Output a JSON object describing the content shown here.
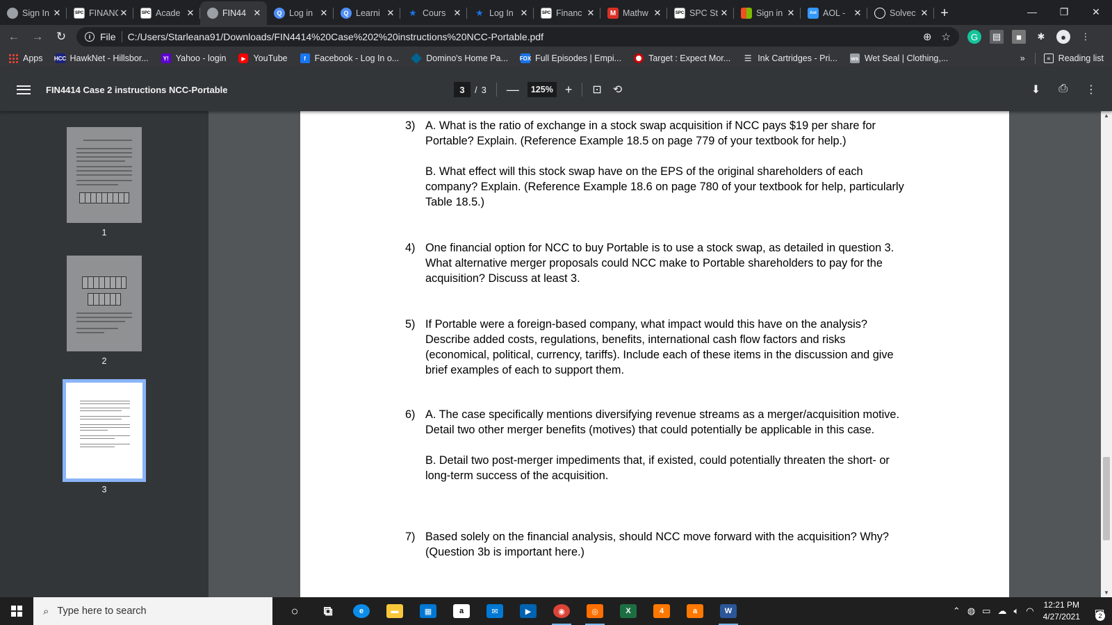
{
  "tabs": [
    {
      "title": "Sign In",
      "favicon": "globe-icon",
      "color": "#5f6368",
      "active": false
    },
    {
      "title": "FINANC",
      "favicon": "spc-icon",
      "color": "#ffffff",
      "active": false
    },
    {
      "title": "Acade",
      "favicon": "spc-icon",
      "color": "#ffffff",
      "active": false
    },
    {
      "title": "FIN44",
      "favicon": "globe-icon",
      "color": "#5f6368",
      "active": true
    },
    {
      "title": "Log in",
      "favicon": "q-icon",
      "color": "#4f8ef7",
      "active": false
    },
    {
      "title": "Learni",
      "favicon": "q-icon",
      "color": "#4f8ef7",
      "active": false
    },
    {
      "title": "Cours",
      "favicon": "star-icon",
      "color": "#1a73e8",
      "active": false
    },
    {
      "title": "Log In",
      "favicon": "star-icon",
      "color": "#1a73e8",
      "active": false
    },
    {
      "title": "Financ",
      "favicon": "spc-icon",
      "color": "#ffffff",
      "active": false
    },
    {
      "title": "Mathw",
      "favicon": "m-icon",
      "color": "#d93025",
      "active": false
    },
    {
      "title": "SPC St",
      "favicon": "spc-icon",
      "color": "#ffffff",
      "active": false
    },
    {
      "title": "Sign in",
      "favicon": "microsoft-icon",
      "color": "#f25022",
      "active": false
    },
    {
      "title": "AOL -",
      "favicon": "aol-icon",
      "color": "#3399ff",
      "active": false
    },
    {
      "title": "Solvec",
      "favicon": "solved-icon",
      "color": "#4285f4",
      "active": false
    }
  ],
  "url": {
    "scheme_label": "File",
    "path": "C:/Users/Starleana91/Downloads/FIN4414%20Case%202%20instructions%20NCC-Portable.pdf"
  },
  "bookmarks": [
    {
      "label": "Apps",
      "icon": "apps-grid-icon",
      "color": "#34a853"
    },
    {
      "label": "HawkNet - Hillsbor...",
      "icon": "hcc-icon",
      "color": "#1a237e"
    },
    {
      "label": "Yahoo - login",
      "icon": "yahoo-icon",
      "color": "#6001d2"
    },
    {
      "label": "YouTube",
      "icon": "youtube-icon",
      "color": "#ff0000"
    },
    {
      "label": "Facebook - Log In o...",
      "icon": "facebook-icon",
      "color": "#1877f2"
    },
    {
      "label": "Domino's Home Pa...",
      "icon": "dominos-icon",
      "color": "#006491"
    },
    {
      "label": "Full Episodes | Empi...",
      "icon": "fox-icon",
      "color": "#1a73e8"
    },
    {
      "label": "Target : Expect Mor...",
      "icon": "target-icon",
      "color": "#cc0000"
    },
    {
      "label": "Ink Cartridges - Pri...",
      "icon": "list-icon",
      "color": "#5f6368"
    },
    {
      "label": "Wet Seal | Clothing,...",
      "icon": "wetseal-icon",
      "color": "#5f6368"
    }
  ],
  "bookmarks_overflow": "»",
  "reading_list": "Reading list",
  "pdf": {
    "title": "FIN4414 Case 2 instructions NCC-Portable",
    "current_page": "3",
    "page_sep": "/",
    "total_pages": "3",
    "zoom": "125%",
    "thumbnail_labels": [
      "1",
      "2",
      "3"
    ]
  },
  "questions": [
    {
      "num": "3)",
      "paragraphs": [
        "A. What is the ratio of exchange in a stock swap acquisition if NCC pays $19 per share for Portable? Explain. (Reference Example 18.5 on page 779 of your textbook for help.)",
        "B. What effect will this stock swap have on the EPS of the original shareholders of each company? Explain. (Reference Example 18.6 on page 780 of your textbook for help, particularly Table 18.5.)"
      ]
    },
    {
      "num": "4)",
      "paragraphs": [
        "One financial option for NCC to buy Portable is to use a stock swap, as detailed in question 3. What alternative merger proposals could NCC make to Portable shareholders to pay for the acquisition? Discuss at least 3."
      ]
    },
    {
      "num": "5)",
      "paragraphs": [
        "If Portable were a foreign-based company, what impact would this have on the analysis? Describe added costs, regulations, benefits, international cash flow factors and risks (economical, political, currency, tariffs). Include each of these items in the discussion and give brief examples of each to support them."
      ]
    },
    {
      "num": "6)",
      "paragraphs": [
        "A. The case specifically mentions diversifying revenue streams as a merger/acquisition motive. Detail two other merger benefits (motives) that could potentially be applicable in this case.",
        "B. Detail two post-merger impediments that, if existed, could potentially threaten the short- or long-term success of the acquisition."
      ]
    },
    {
      "num": "7)",
      "paragraphs": [
        "Based solely on the financial analysis, should NCC move forward with the acquisition? Why? (Question 3b is important here.)"
      ]
    }
  ],
  "taskbar": {
    "search_placeholder": "Type here to search",
    "time": "12:21 PM",
    "date": "4/27/2021",
    "notification_count": "2",
    "apps": [
      {
        "name": "cortana-icon",
        "label": "○",
        "color": "transparent"
      },
      {
        "name": "task-view-icon",
        "label": "⧉",
        "color": "transparent"
      },
      {
        "name": "edge-icon",
        "label": "e",
        "color": "#0c8ce9"
      },
      {
        "name": "file-explorer-icon",
        "label": "▬",
        "color": "#f8c83a"
      },
      {
        "name": "store-icon",
        "label": "▦",
        "color": "#0078d4"
      },
      {
        "name": "amazon-icon",
        "label": "a",
        "color": "#ffffff"
      },
      {
        "name": "mail-icon",
        "label": "✉",
        "color": "#0078d4"
      },
      {
        "name": "media-player-icon",
        "label": "▶",
        "color": "#0063b1"
      },
      {
        "name": "chrome-icon",
        "label": "◉",
        "color": "#db4437"
      },
      {
        "name": "photo-app-icon",
        "label": "◎",
        "color": "#ff6f00"
      },
      {
        "name": "excel-icon",
        "label": "X",
        "color": "#1d6f42"
      },
      {
        "name": "avast-icon",
        "label": "4",
        "color": "#ff7800"
      },
      {
        "name": "avast-secure-icon",
        "label": "a",
        "color": "#ff7800"
      },
      {
        "name": "word-icon",
        "label": "W",
        "color": "#2b579a"
      }
    ]
  }
}
